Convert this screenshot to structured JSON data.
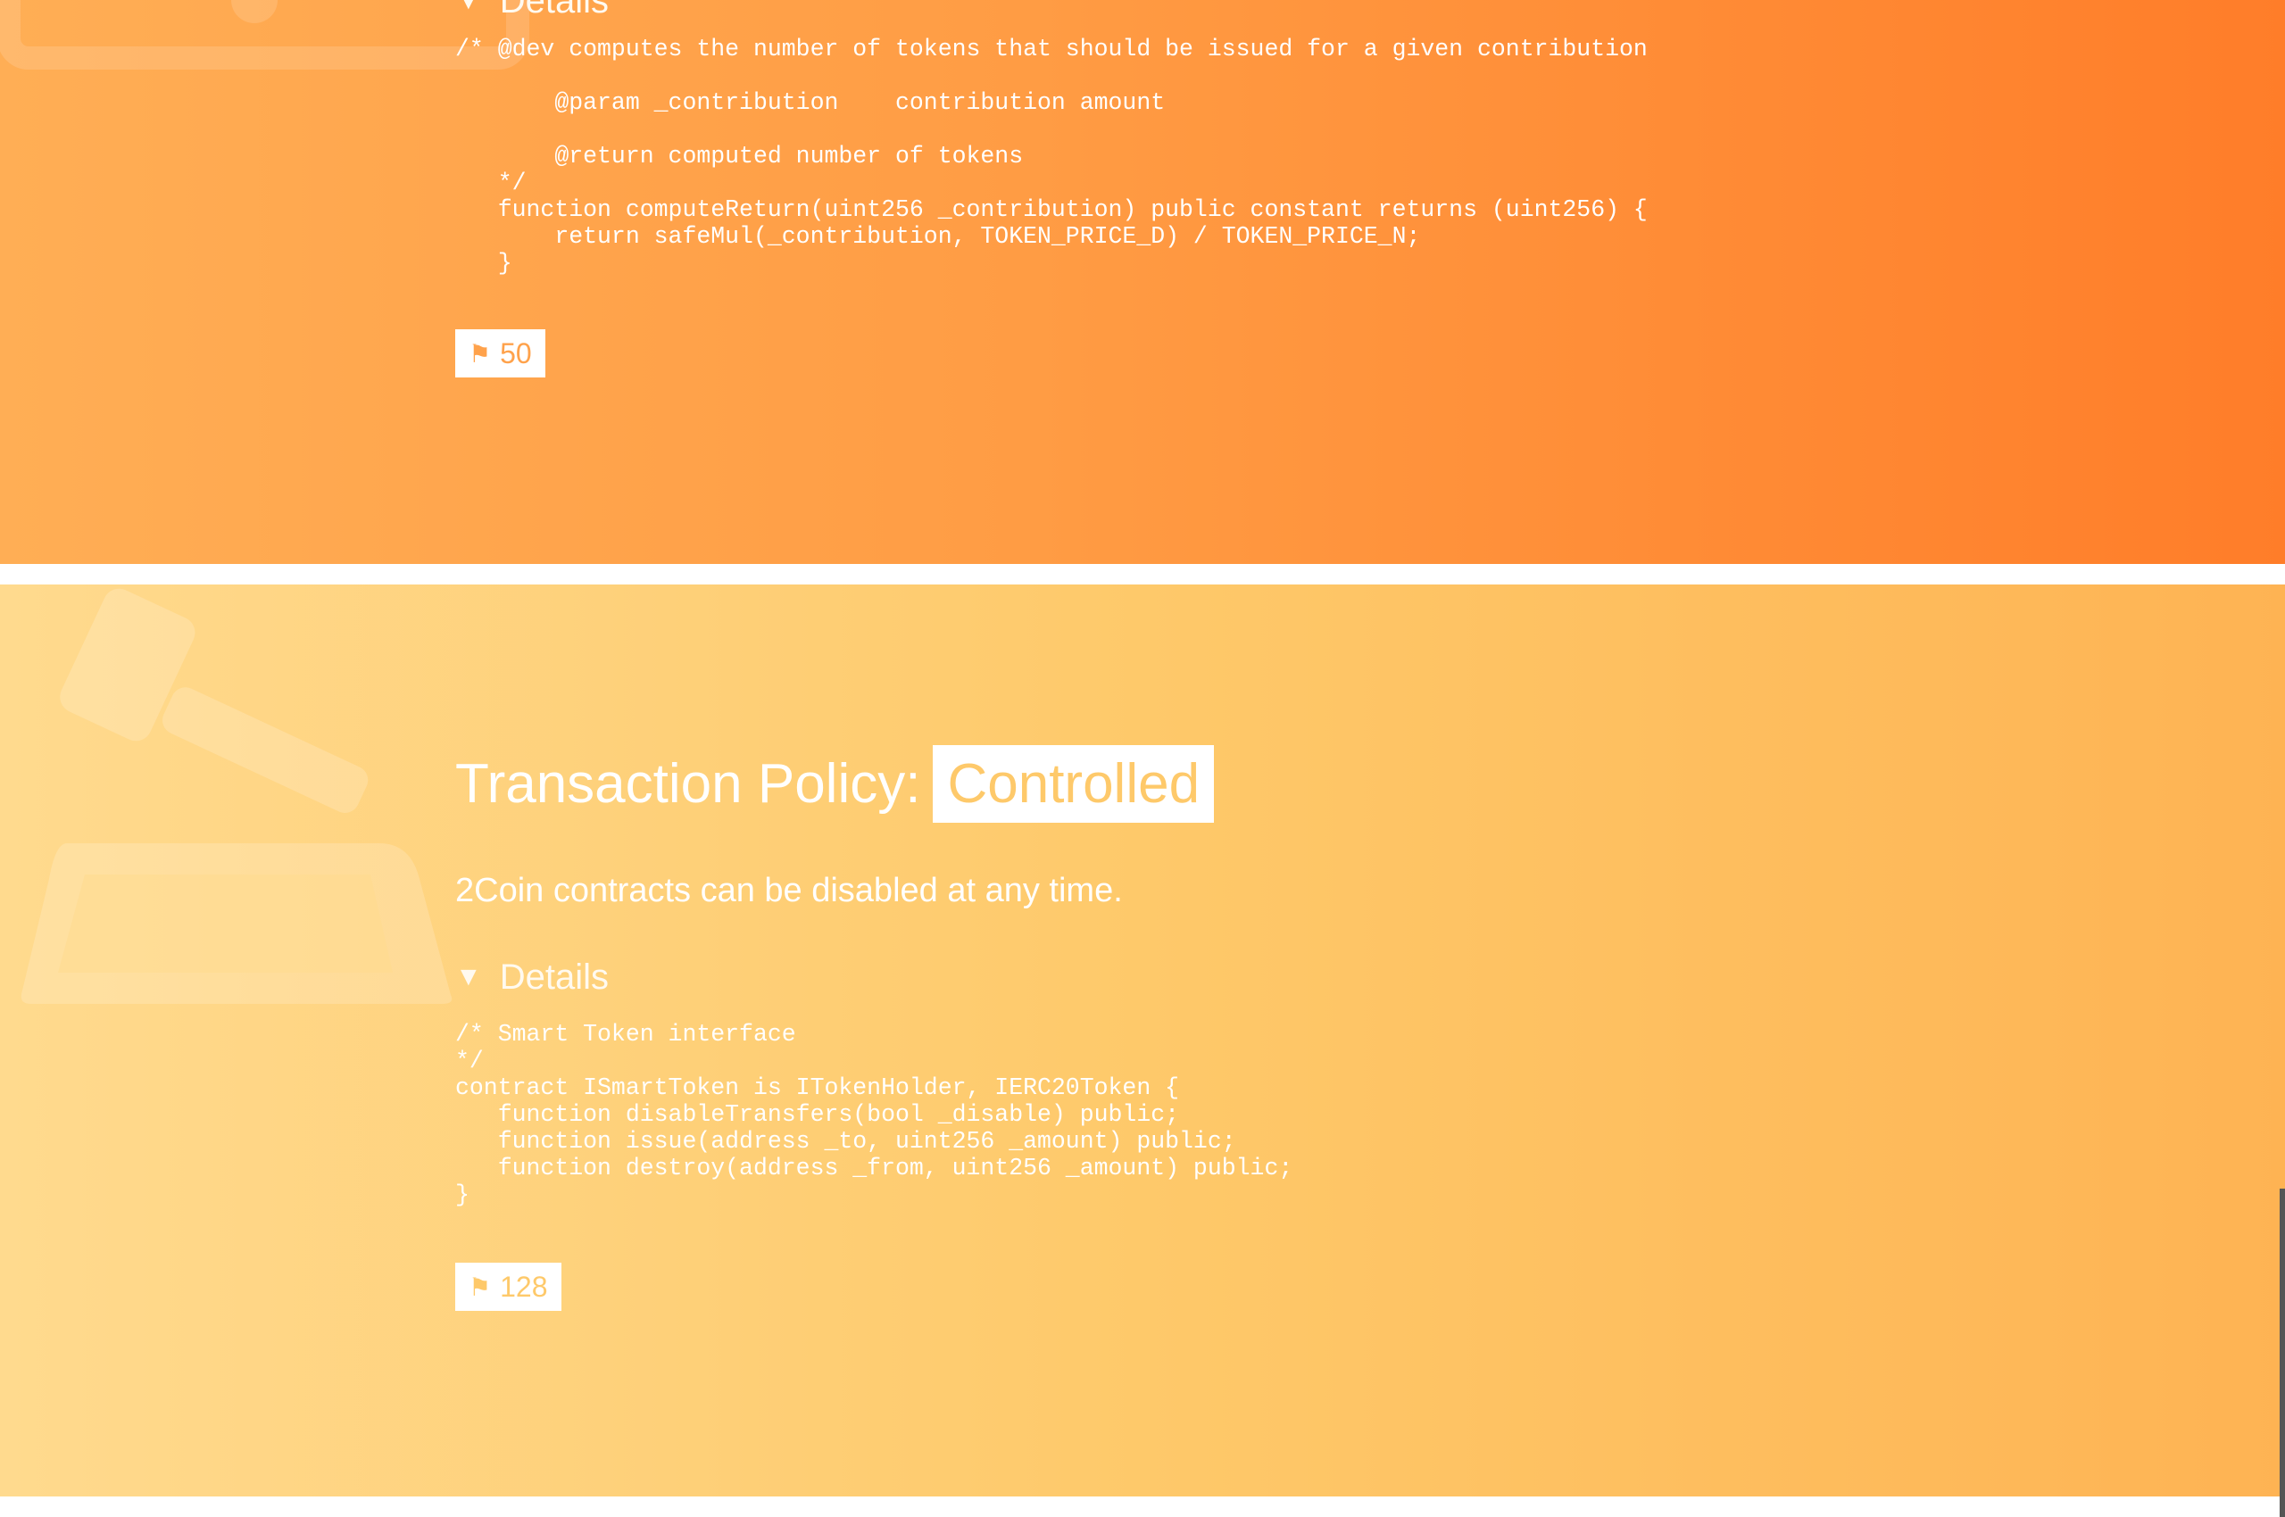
{
  "colors": {
    "top_section_gradient": [
      "#ffae55",
      "#ff7d29"
    ],
    "bottom_section_gradient": [
      "#ffda8e",
      "#feb353"
    ],
    "badge_text_top": "#ffa24b",
    "badge_text_bottom": "#fec96a"
  },
  "top_section": {
    "details_label": "Details",
    "code": "/* @dev computes the number of tokens that should be issued for a given contribution\n\n       @param _contribution    contribution amount\n\n       @return computed number of tokens\n   */\n   function computeReturn(uint256 _contribution) public constant returns (uint256) {\n       return safeMul(_contribution, TOKEN_PRICE_D) / TOKEN_PRICE_N;\n   }",
    "flag_count": "50",
    "icon": "gavel-icon"
  },
  "bottom_section": {
    "policy_label": "Transaction Policy:",
    "policy_value": "Controlled",
    "description": "2Coin contracts can be disabled at any time.",
    "details_label": "Details",
    "code": "/* Smart Token interface\n*/\ncontract ISmartToken is ITokenHolder, IERC20Token {\n   function disableTransfers(bool _disable) public;\n   function issue(address _to, uint256 _amount) public;\n   function destroy(address _from, uint256 _amount) public;\n}",
    "flag_count": "128",
    "icon": "gavel-icon"
  }
}
